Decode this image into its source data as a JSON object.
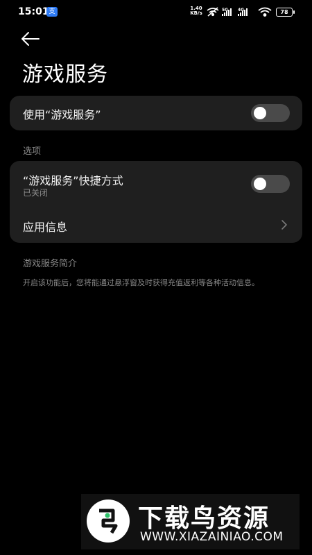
{
  "status_bar": {
    "time": "15:01",
    "app_icon_glyph": "支",
    "net_speed_value": "1.40",
    "net_speed_unit": "KB/s",
    "battery": "78",
    "icons": [
      "wifi-off-icon",
      "signal-5g-icon",
      "signal-4g-icon",
      "wifi-icon"
    ]
  },
  "header": {
    "back_icon": "arrow-left-icon",
    "title": "游戏服务"
  },
  "main_toggle": {
    "label": "使用“游戏服务”",
    "enabled": false
  },
  "options_section": {
    "label": "选项",
    "shortcut": {
      "label": "“游戏服务”快捷方式",
      "sub": "已关闭",
      "enabled": false
    },
    "app_info": {
      "label": "应用信息",
      "icon": "chevron-right-icon"
    }
  },
  "intro": {
    "heading": "游戏服务简介",
    "text": "开启该功能后，您将能通过悬浮窗及时获得充值返利等各种活动信息。"
  },
  "watermark": {
    "title": "下载鸟资源",
    "url": "WWW.XIAZAINIAO.COM"
  },
  "colors": {
    "background": "#000000",
    "card": "#1f1f1f",
    "toggle_off": "#4a4a4a",
    "secondary_text": "#8a8a8a"
  }
}
